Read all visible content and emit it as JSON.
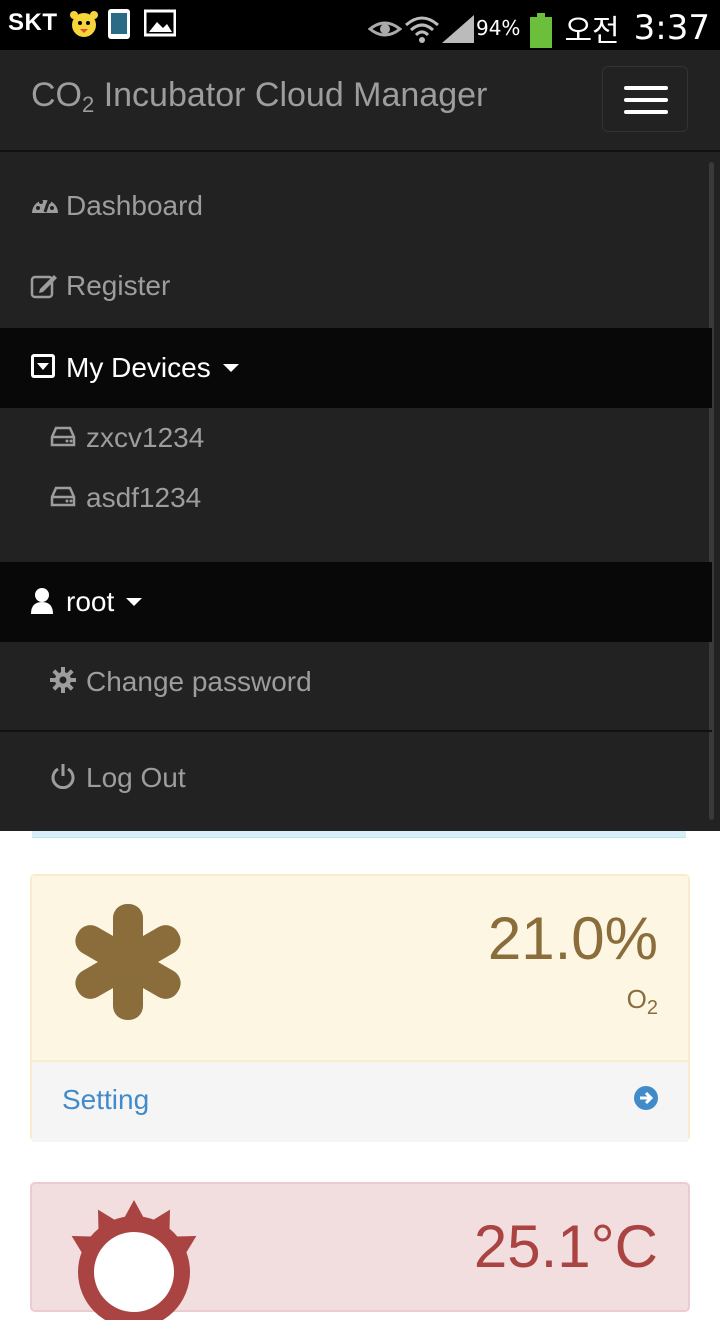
{
  "status_bar": {
    "carrier": "SKT",
    "battery_percent": "94%",
    "ampm": "오전",
    "time": "3:37"
  },
  "navbar": {
    "brand_prefix": "CO",
    "brand_sub": "2",
    "brand_suffix": " Incubator Cloud Manager"
  },
  "menu": {
    "dashboard": "Dashboard",
    "register": "Register",
    "my_devices": "My Devices",
    "devices": [
      "zxcv1234",
      "asdf1234"
    ],
    "user": "root",
    "change_password": "Change password",
    "logout": "Log Out"
  },
  "panels": {
    "o2": {
      "value": "21.0%",
      "label_prefix": "O",
      "label_sub": "2",
      "setting": "Setting"
    },
    "temp": {
      "value": "25.1°C"
    }
  },
  "colors": {
    "navbar_bg": "#222222",
    "warning_text": "#8a6d3b",
    "danger_text": "#a94442",
    "link": "#428bca"
  }
}
